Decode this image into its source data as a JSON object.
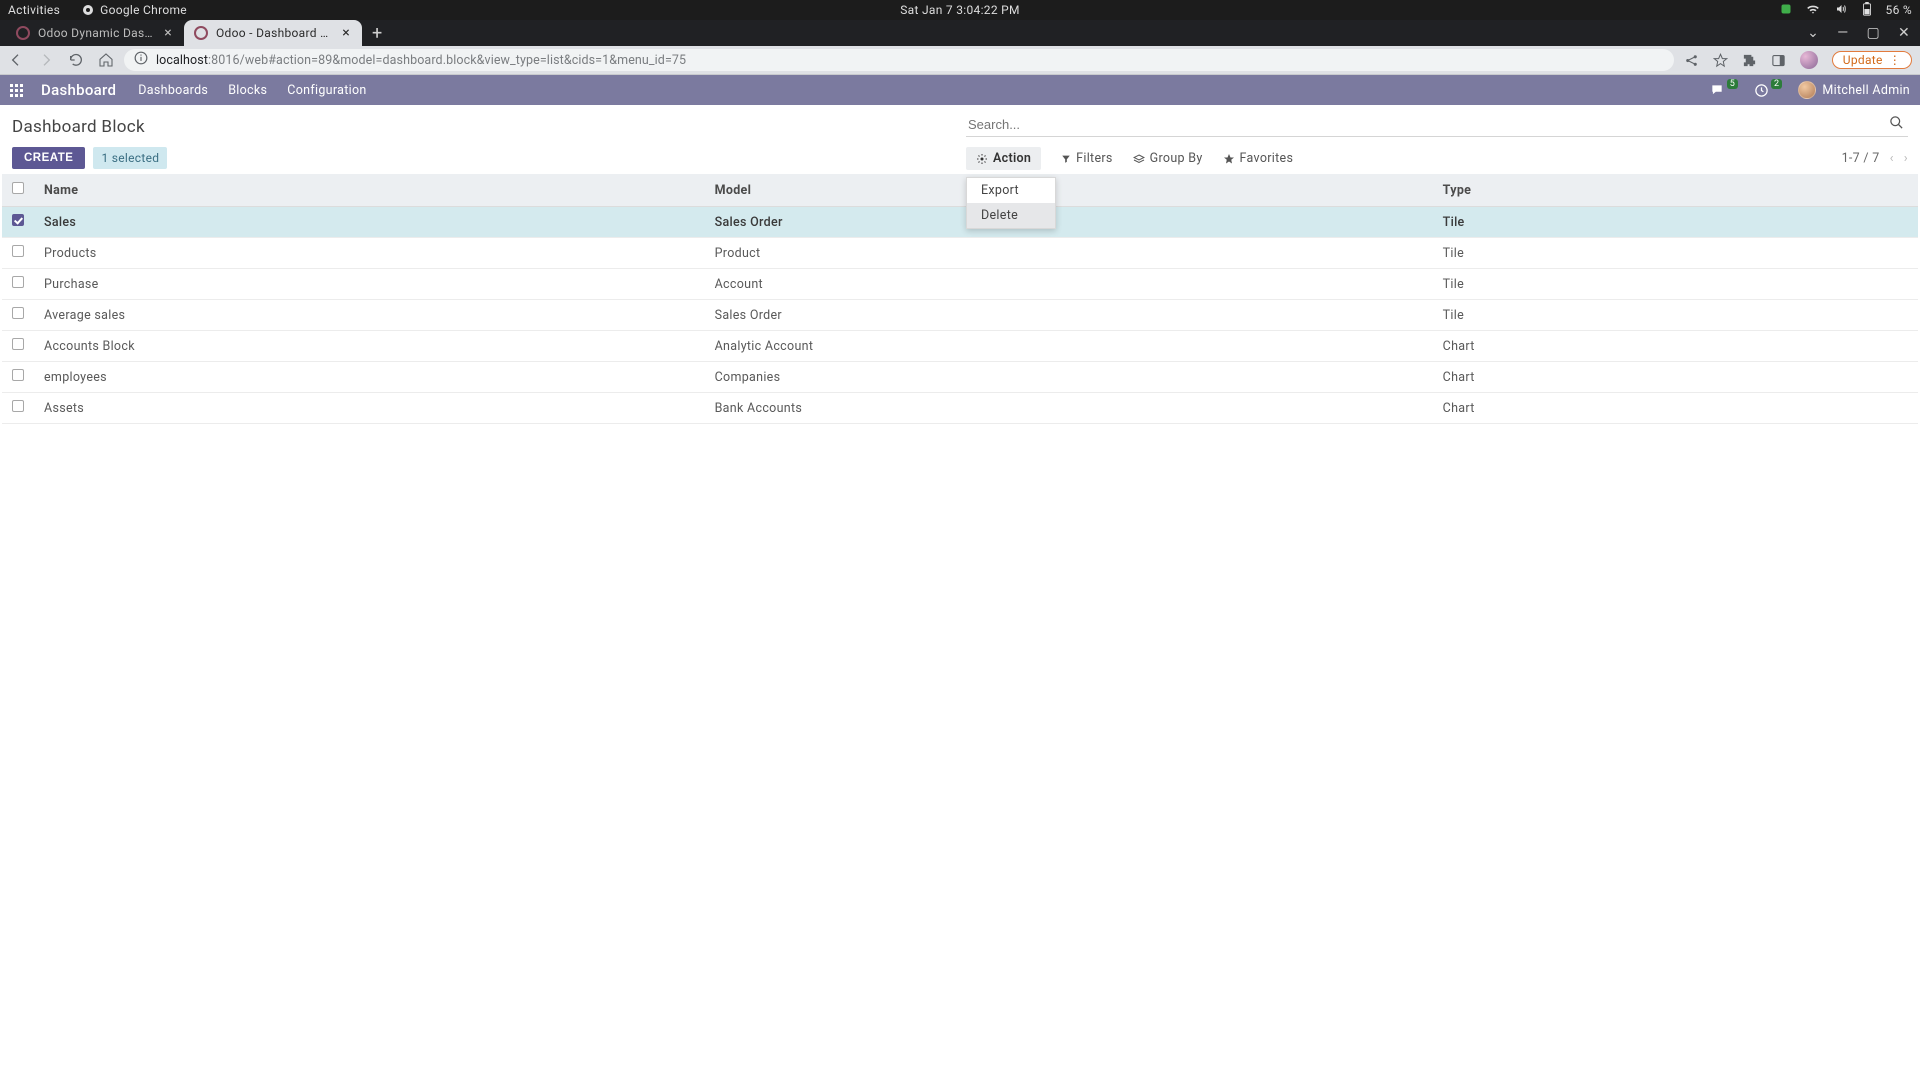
{
  "os": {
    "activities": "Activities",
    "browser_name": "Google Chrome",
    "clock": "Sat Jan 7   3:04:22 PM",
    "battery": "56 %"
  },
  "browser": {
    "tabs": [
      {
        "title": "Odoo Dynamic Dashboard",
        "active": false
      },
      {
        "title": "Odoo - Dashboard Block",
        "active": true
      }
    ],
    "url_host": "localhost",
    "url_rest": ":8016/web#action=89&model=dashboard.block&view_type=list&cids=1&menu_id=75",
    "update_label": "Update"
  },
  "odoo": {
    "app_name": "Dashboard",
    "menu": [
      "Dashboards",
      "Blocks",
      "Configuration"
    ],
    "msg_badge": "5",
    "act_badge": "2",
    "user_name": "Mitchell Admin"
  },
  "page": {
    "title": "Dashboard Block",
    "create_label": "CREATE",
    "selected_label": "1 selected",
    "search_placeholder": "Search..."
  },
  "toolbar": {
    "action": "Action",
    "filters": "Filters",
    "group_by": "Group By",
    "favorites": "Favorites",
    "pager": "1-7 / 7",
    "dropdown": {
      "export": "Export",
      "delete": "Delete"
    }
  },
  "table": {
    "headers": {
      "name": "Name",
      "model": "Model",
      "type": "Type"
    },
    "rows": [
      {
        "checked": true,
        "name": "Sales",
        "model": "Sales Order",
        "type": "Tile"
      },
      {
        "checked": false,
        "name": "Products",
        "model": "Product",
        "type": "Tile"
      },
      {
        "checked": false,
        "name": "Purchase",
        "model": "Account",
        "type": "Tile"
      },
      {
        "checked": false,
        "name": "Average sales",
        "model": "Sales Order",
        "type": "Tile"
      },
      {
        "checked": false,
        "name": "Accounts Block",
        "model": "Analytic Account",
        "type": "Chart"
      },
      {
        "checked": false,
        "name": "employees",
        "model": "Companies",
        "type": "Chart"
      },
      {
        "checked": false,
        "name": "Assets",
        "model": "Bank Accounts",
        "type": "Chart"
      }
    ]
  }
}
